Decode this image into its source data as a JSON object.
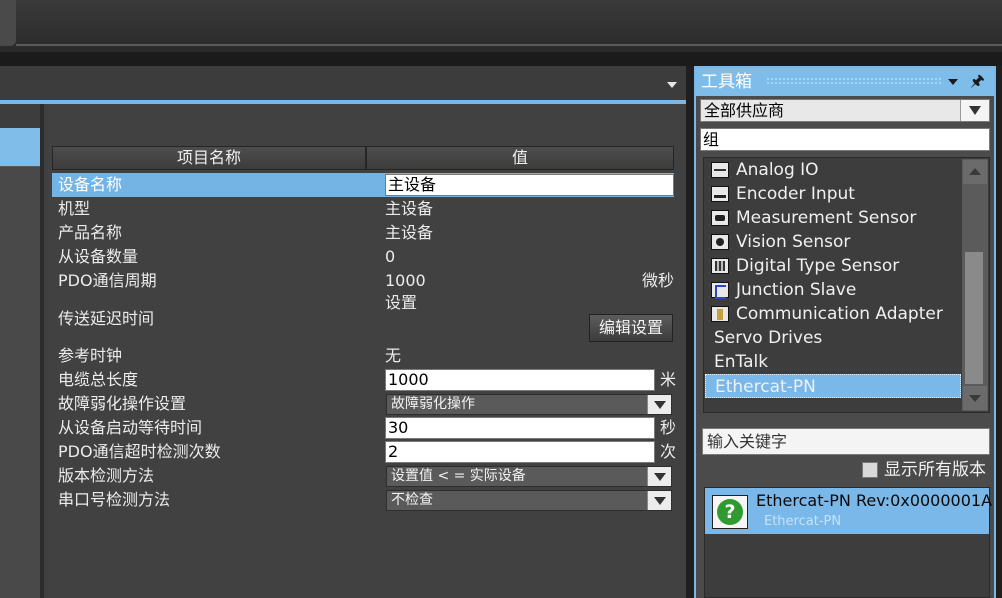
{
  "properties": {
    "header": {
      "name_col": "项目名称",
      "value_col": "值"
    },
    "rows": [
      {
        "name": "设备名称",
        "value": "主设备"
      },
      {
        "name": "机型",
        "value": "主设备"
      },
      {
        "name": "产品名称",
        "value": "主设备"
      },
      {
        "name": "从设备数量",
        "value": "0"
      },
      {
        "name": "PDO通信周期",
        "value": "1000",
        "unit": "微秒"
      },
      {
        "name": "传送延迟时间",
        "value": "设置",
        "button": "编辑设置"
      },
      {
        "name": "参考时钟",
        "value": "无"
      },
      {
        "name": "电缆总长度",
        "value": "1000",
        "unit": "米"
      },
      {
        "name": "故障弱化操作设置",
        "value": "故障弱化操作"
      },
      {
        "name": "从设备启动等待时间",
        "value": "30",
        "unit": "秒"
      },
      {
        "name": "PDO通信超时检测次数",
        "value": "2",
        "unit": "次"
      },
      {
        "name": "版本检测方法",
        "value": "设置值 < = 实际设备"
      },
      {
        "name": "串口号检测方法",
        "value": "不检查"
      }
    ]
  },
  "toolbox": {
    "title": "工具箱",
    "vendor_filter": "全部供应商",
    "group_input": "组",
    "groups": [
      {
        "label": "Analog IO",
        "icon": "analog-io-icon"
      },
      {
        "label": "Encoder Input",
        "icon": "encoder-input-icon"
      },
      {
        "label": "Measurement Sensor",
        "icon": "measurement-sensor-icon"
      },
      {
        "label": "Vision Sensor",
        "icon": "vision-sensor-icon"
      },
      {
        "label": "Digital Type Sensor",
        "icon": "digital-type-sensor-icon"
      },
      {
        "label": "Junction Slave",
        "icon": "junction-slave-icon"
      },
      {
        "label": "Communication Adapter",
        "icon": "communication-adapter-icon"
      },
      {
        "label": "Servo Drives"
      },
      {
        "label": "EnTalk"
      },
      {
        "label": "Ethercat-PN",
        "selected": true
      }
    ],
    "search_placeholder": "输入关键字",
    "show_all_versions": "显示所有版本",
    "result": {
      "name": "Ethercat-PN Rev:0x0000001A",
      "sub": "Ethercat-PN",
      "icon": "unknown-device-icon"
    }
  }
}
